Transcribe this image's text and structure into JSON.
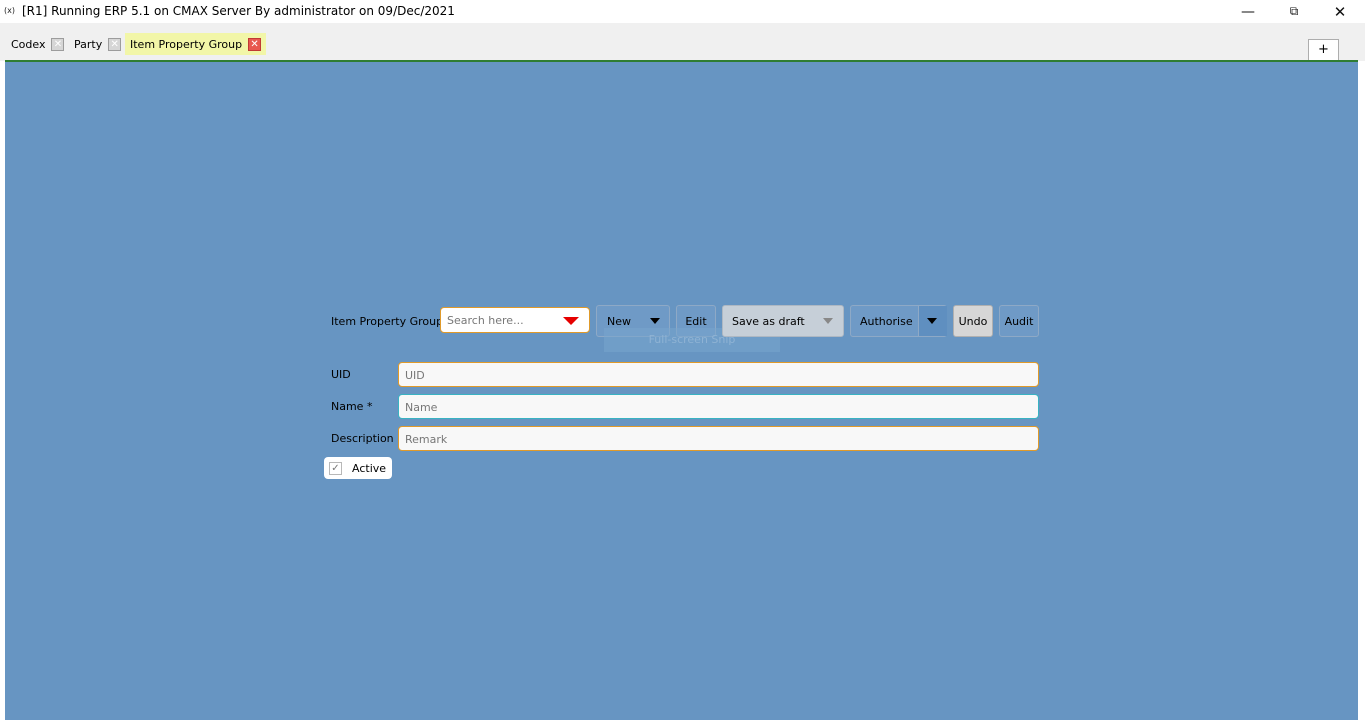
{
  "window": {
    "app_icon": "(x)",
    "title": "[R1] Running ERP 5.1 on CMAX Server By administrator on 09/Dec/2021",
    "minimize_glyph": "—",
    "restore_glyph": "⧉",
    "close_glyph": "✕"
  },
  "tabs": [
    {
      "label": "Codex",
      "active": false
    },
    {
      "label": "Party",
      "active": false
    },
    {
      "label": "Item Property Group",
      "active": true
    }
  ],
  "tab_close_glyph": "✕",
  "add_tab_label": "+",
  "form": {
    "entity_label": "Item Property Group",
    "search_placeholder": "Search here...",
    "buttons": {
      "new": "New",
      "edit": "Edit",
      "save_as_draft": "Save as draft",
      "authorise": "Authorise",
      "undo": "Undo",
      "audit": "Audit"
    },
    "overlay_text": "Full-screen Snip",
    "fields": {
      "uid": {
        "label": "UID",
        "placeholder": "UID",
        "value": ""
      },
      "name": {
        "label": "Name *",
        "placeholder": "Name",
        "value": ""
      },
      "description": {
        "label": "Description",
        "placeholder": "Remark",
        "value": ""
      }
    },
    "active": {
      "label": "Active",
      "checked": true,
      "check_glyph": "✓"
    }
  },
  "colors": {
    "content_bg": "#6795c2",
    "tab_active_bg": "#f2f6a8",
    "accent_line": "#2f7d32",
    "field_border": "#e09a2a",
    "search_arrow": "#e60000"
  }
}
